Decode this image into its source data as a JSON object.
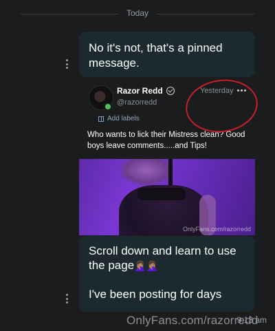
{
  "divider": {
    "label": "Today"
  },
  "messages": {
    "top": "No it's not, that's a pinned message.",
    "bottom_line1": "Scroll down and learn to use the page",
    "bottom_emoji": "🤦🏽‍♀️🤦🏽‍♀️",
    "bottom_line2": "I've been posting for days"
  },
  "post": {
    "author": "Razor Redd",
    "handle": "@razorredd",
    "time": "Yesterday",
    "add_labels": "Add labels",
    "text": "Who wants to lick their Mistress clean? Good boys leave comments.....and Tips!",
    "photo_watermark": "OnlyFans.com/razorredd"
  },
  "footer": {
    "time": "9:13 am",
    "watermark": "OnlyFans.com/razorredd"
  },
  "annotation": {
    "circle_color": "#c8202a"
  },
  "icons": [
    "kebab-icon",
    "verified-icon",
    "more-icon",
    "label-icon"
  ]
}
